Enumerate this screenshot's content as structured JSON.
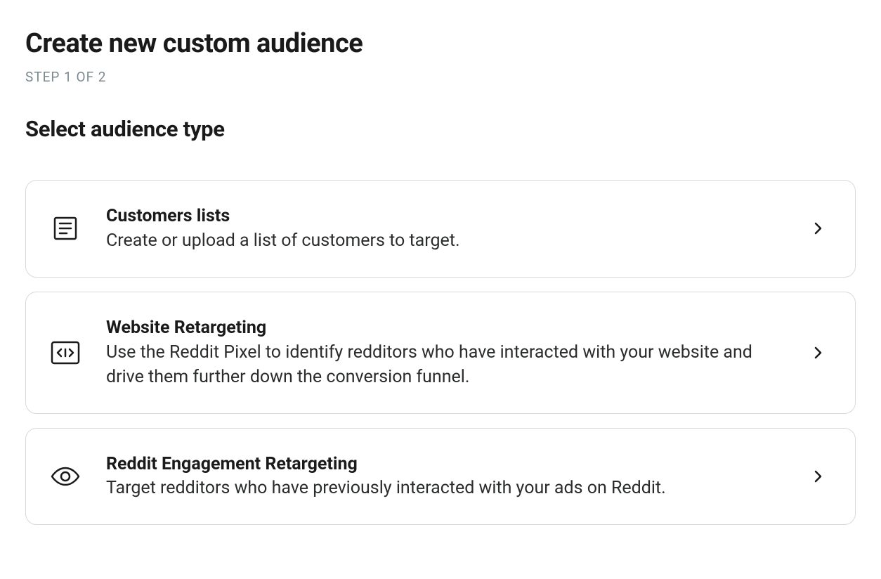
{
  "header": {
    "title": "Create new custom audience",
    "step": "STEP 1 OF 2"
  },
  "section": {
    "title": "Select audience type"
  },
  "options": [
    {
      "title": "Customers lists",
      "description": "Create or upload a list of customers to target."
    },
    {
      "title": "Website Retargeting",
      "description": "Use the Reddit Pixel to identify redditors who have interacted with your website and drive them further down the conversion funnel."
    },
    {
      "title": "Reddit Engagement Retargeting",
      "description": "Target redditors who have previously interacted with your ads on Reddit."
    }
  ]
}
